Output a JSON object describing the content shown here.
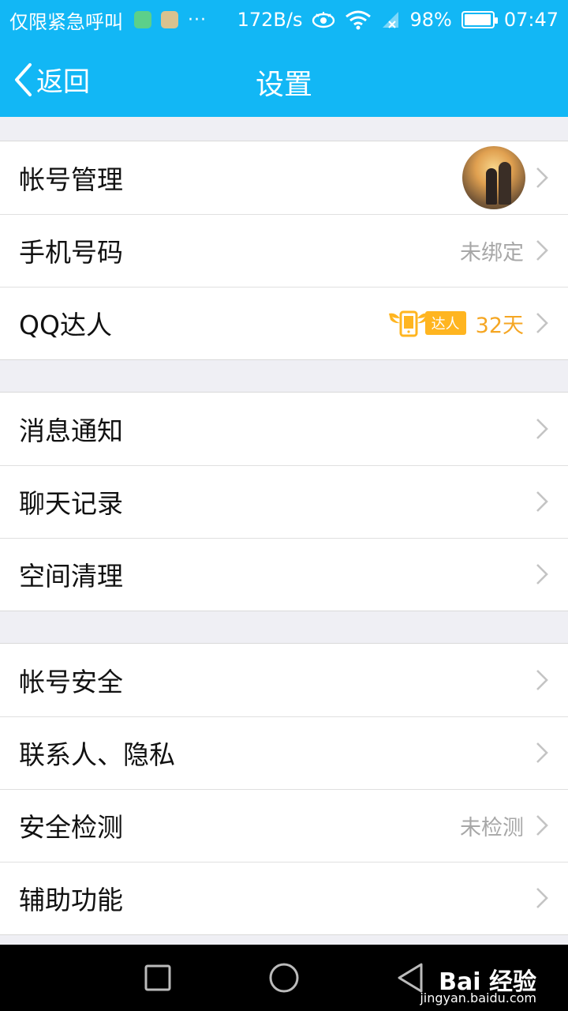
{
  "status_bar": {
    "carrier": "仅限紧急呼叫",
    "dots": "···",
    "net_speed": "172B/s",
    "battery": "98%",
    "battery_level": 0.98,
    "time": "07:47"
  },
  "nav": {
    "back_label": "返回",
    "title": "设置"
  },
  "groups": [
    {
      "items": [
        {
          "label": "帐号管理",
          "has_avatar": true
        },
        {
          "label": "手机号码",
          "value": "未绑定"
        },
        {
          "label": "QQ达人",
          "badge": "达人",
          "days": "32天"
        }
      ]
    },
    {
      "items": [
        {
          "label": "消息通知"
        },
        {
          "label": "聊天记录"
        },
        {
          "label": "空间清理"
        }
      ]
    },
    {
      "items": [
        {
          "label": "帐号安全"
        },
        {
          "label": "联系人、隐私"
        },
        {
          "label": "安全检测",
          "value": "未检测"
        },
        {
          "label": "辅助功能"
        }
      ]
    }
  ],
  "watermark": {
    "brand": "Bai 经验",
    "url": "jingyan.baidu.com"
  },
  "colors": {
    "header": "#12b7f5",
    "badge": "#ffb520",
    "days": "#f5a623"
  }
}
